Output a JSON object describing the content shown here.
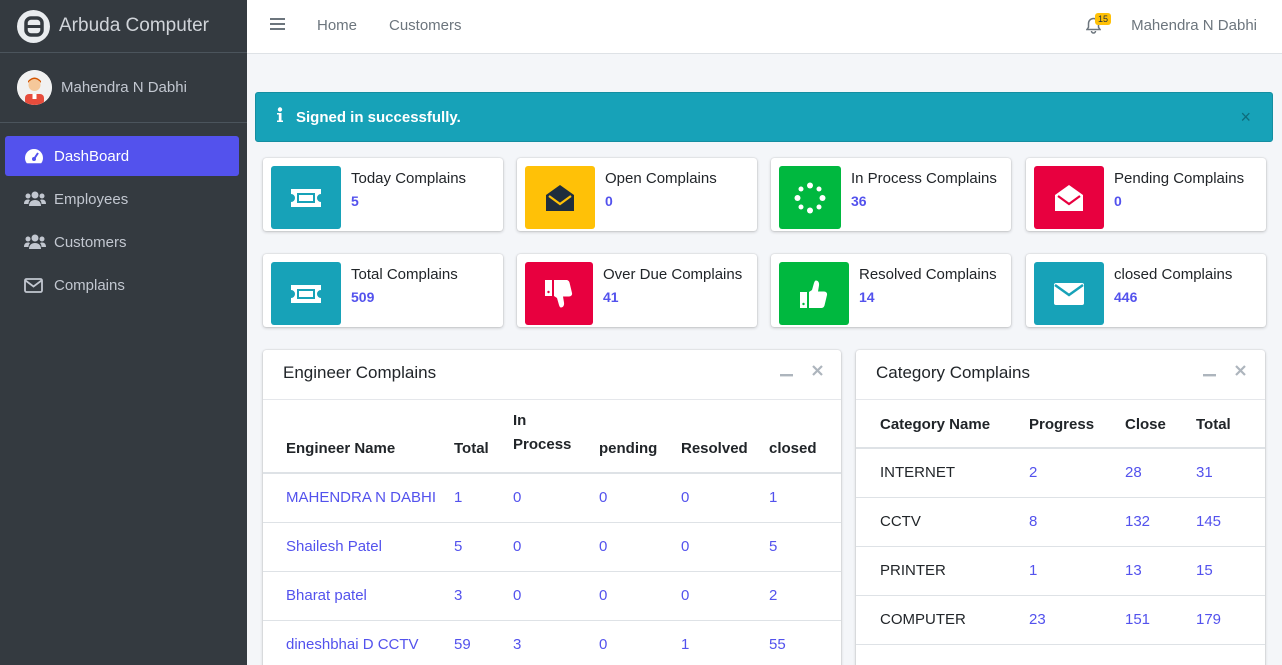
{
  "brand": {
    "name": "Arbuda Computer"
  },
  "sidebar": {
    "user_name": "Mahendra N Dabhi",
    "items": [
      {
        "label": "DashBoard",
        "icon": "tachometer-icon",
        "active": true
      },
      {
        "label": "Employees",
        "icon": "users-icon"
      },
      {
        "label": "Customers",
        "icon": "users-icon"
      },
      {
        "label": "Complains",
        "icon": "envelope-icon"
      }
    ]
  },
  "topbar": {
    "links": [
      "Home",
      "Customers"
    ],
    "notification_count": "15",
    "user_name": "Mahendra N Dabhi"
  },
  "alert": {
    "message": "Signed in successfully.",
    "close": "×"
  },
  "info_boxes": [
    {
      "label": "Today Complains",
      "value": "5",
      "color": "#17a2b8",
      "icon": "ticket-icon"
    },
    {
      "label": "Open Complains",
      "value": "0",
      "color": "#ffc107",
      "icon": "envelope-open-icon"
    },
    {
      "label": "In Process Complains",
      "value": "36",
      "color": "#00b83f",
      "icon": "spinner-icon"
    },
    {
      "label": "Pending Complains",
      "value": "0",
      "color": "#e8003f",
      "icon": "envelope-open-icon"
    },
    {
      "label": "Total Complains",
      "value": "509",
      "color": "#17a2b8",
      "icon": "ticket-icon"
    },
    {
      "label": "Over Due Complains",
      "value": "41",
      "color": "#e8003f",
      "icon": "thumbs-down-icon"
    },
    {
      "label": "Resolved Complains",
      "value": "14",
      "color": "#00b83f",
      "icon": "thumbs-up-icon"
    },
    {
      "label": "closed Complains",
      "value": "446",
      "color": "#17a2b8",
      "icon": "envelope-icon"
    }
  ],
  "engineer_card": {
    "title": "Engineer Complains",
    "headers": [
      "Engineer Name",
      "Total",
      "In Process",
      "pending",
      "Resolved",
      "closed"
    ],
    "rows": [
      [
        "MAHENDRA N DABHI",
        "1",
        "0",
        "0",
        "0",
        "1"
      ],
      [
        "Shailesh Patel",
        "5",
        "0",
        "0",
        "0",
        "5"
      ],
      [
        "Bharat patel",
        "3",
        "0",
        "0",
        "0",
        "2"
      ],
      [
        "dineshbhai D CCTV",
        "59",
        "3",
        "0",
        "1",
        "55"
      ]
    ]
  },
  "category_card": {
    "title": "Category Complains",
    "headers": [
      "Category Name",
      "Progress",
      "Close",
      "Total"
    ],
    "rows": [
      [
        "INTERNET",
        "2",
        "28",
        "31"
      ],
      [
        "CCTV",
        "8",
        "132",
        "145"
      ],
      [
        "PRINTER",
        "1",
        "13",
        "15"
      ],
      [
        "COMPUTER",
        "23",
        "151",
        "179"
      ]
    ]
  }
}
